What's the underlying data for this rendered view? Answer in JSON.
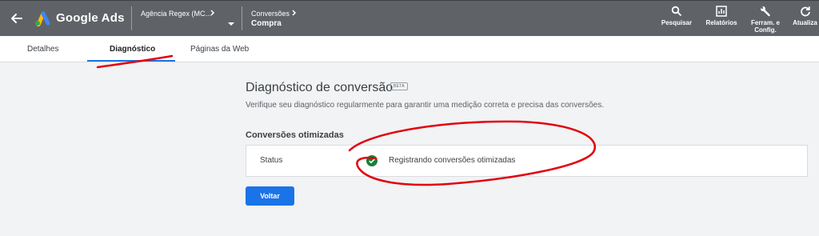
{
  "app": {
    "brand": "Google Ads"
  },
  "header": {
    "account": "Agência Regex (MC...",
    "breadcrumb": {
      "section": "Conversões",
      "page": "Compra"
    },
    "tools": [
      {
        "label": "Pesquisar",
        "icon": "search-icon"
      },
      {
        "label": "Relatórios",
        "icon": "reports-icon"
      },
      {
        "label": "Ferram. e",
        "label2": "Config.",
        "icon": "wrench-icon"
      },
      {
        "label": "Atualiza",
        "icon": "refresh-icon"
      }
    ]
  },
  "tabs": [
    {
      "label": "Detalhes"
    },
    {
      "label": "Diagnóstico",
      "active": true
    },
    {
      "label": "Páginas da Web"
    }
  ],
  "main": {
    "title": "Diagnóstico de conversão",
    "badge": "BETA",
    "subtitle": "Verifique seu diagnóstico regularmente para garantir uma medição correta e precisa das conversões.",
    "section_title": "Conversões otimizadas",
    "status_label": "Status",
    "status_value": "Registrando conversões otimizadas",
    "back_button": "Voltar"
  },
  "colors": {
    "topbar": "#5f6368",
    "accent": "#1a73e8",
    "success": "#188038",
    "annotation": "#e3000f"
  }
}
